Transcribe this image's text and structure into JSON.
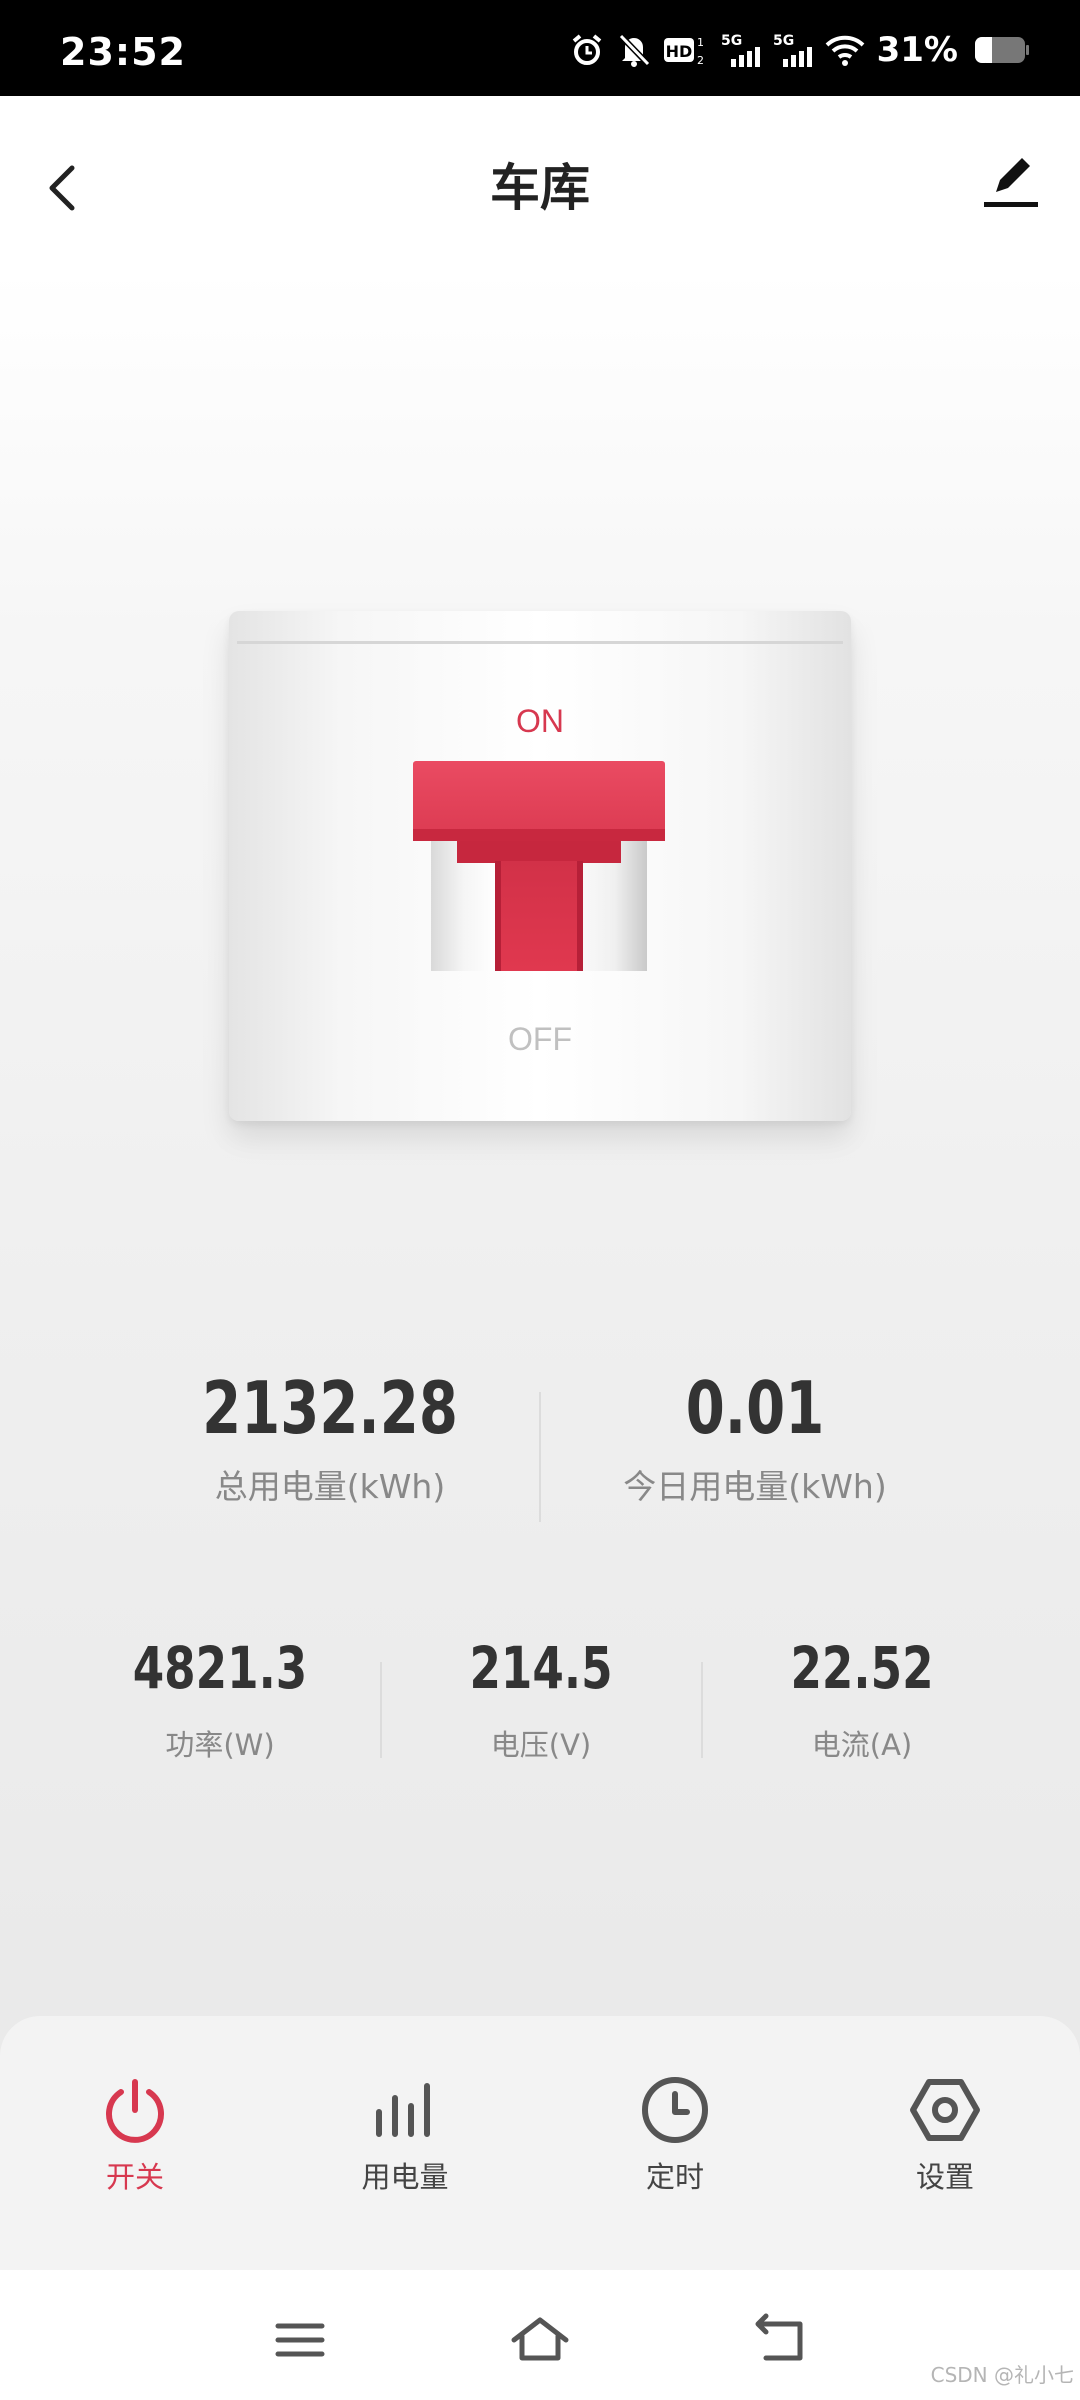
{
  "status_bar": {
    "time": "23:52",
    "network_label_1": "5G",
    "network_label_2": "5G",
    "hd_label": "HD",
    "battery_percent": "31%",
    "battery_level": 0.31,
    "icons": [
      "alarm-icon",
      "mute-icon",
      "hd-voice-icon",
      "signal-5g-icon",
      "signal-5g-icon",
      "wifi-icon",
      "battery-icon"
    ]
  },
  "header": {
    "title": "车库",
    "back_icon": "chevron-left-icon",
    "edit_icon": "edit-pencil-icon"
  },
  "switch": {
    "on_label": "ON",
    "off_label": "OFF",
    "state": "on",
    "accent_color": "#e03a51"
  },
  "stats": {
    "total_energy": {
      "value": "2132.28",
      "label": "总用电量(kWh)"
    },
    "today_energy": {
      "value": "0.01",
      "label": "今日用电量(kWh)"
    },
    "power": {
      "value": "4821.3",
      "label": "功率(W)"
    },
    "voltage": {
      "value": "214.5",
      "label": "电压(V)"
    },
    "current": {
      "value": "22.52",
      "label": "电流(A)"
    }
  },
  "tabs": [
    {
      "label": "开关",
      "icon": "power-icon",
      "active": true
    },
    {
      "label": "用电量",
      "icon": "bar-chart-icon",
      "active": false
    },
    {
      "label": "定时",
      "icon": "clock-icon",
      "active": false
    },
    {
      "label": "设置",
      "icon": "hexagon-settings-icon",
      "active": false
    }
  ],
  "navbar": {
    "icons": [
      "menu-icon",
      "home-icon",
      "back-icon"
    ]
  },
  "watermark": "CSDN @礼小七",
  "colors": {
    "accent": "#d7384f",
    "text_primary": "#333333",
    "text_secondary": "#888888"
  }
}
